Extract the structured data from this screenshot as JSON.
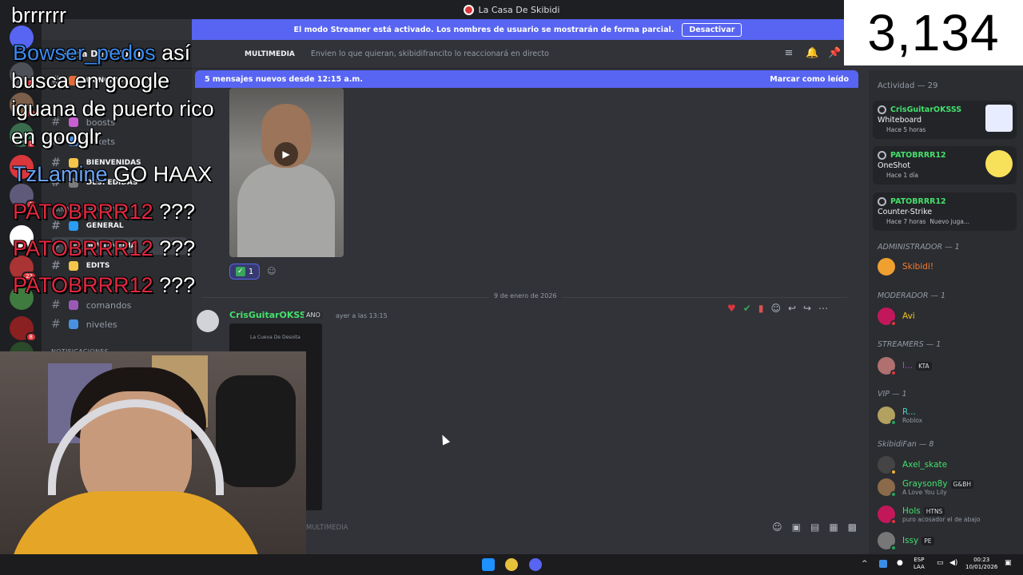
{
  "window": {
    "title": "La Casa De Skibidi"
  },
  "banner": {
    "text": "El modo Streamer está activado. Los nombres de usuario se mostrarán de forma parcial.",
    "button": "Desactivar"
  },
  "server_badges": [
    "1",
    "1",
    "1",
    "1",
    "1",
    "23",
    "8"
  ],
  "channels": {
    "server_name": "Casa De Skibidi",
    "items": [
      {
        "label": "NUNCIOS",
        "style": "bold"
      },
      {
        "label": "boosts",
        "style": "normal"
      },
      {
        "label": "tickets",
        "style": "normal"
      },
      {
        "label": "BIENVENIDAS",
        "style": "bold"
      },
      {
        "label": "DESPEDIDAS",
        "style": "bold"
      },
      {
        "label": "GENERAL",
        "style": "bold"
      },
      {
        "label": "MULTIMEDIA",
        "style": "bold"
      },
      {
        "label": "EDITS",
        "style": "bold"
      },
      {
        "label": "comandos",
        "style": "normal"
      },
      {
        "label": "niveles",
        "style": "normal"
      }
    ],
    "category_general": "CANALES PRINCIPALES",
    "category_notif": "NOTIFICACIONES"
  },
  "chanbar": {
    "name": "MULTIMEDIA",
    "topic": "Envien lo que quieran, skibidifrancito lo reaccionará en directo"
  },
  "newbar": {
    "text": "5 mensajes nuevos desde 12:15 a.m.",
    "action": "Marcar como leído"
  },
  "message1": {
    "reaction_count": "1"
  },
  "divider": {
    "date": "9 de enero de 2026"
  },
  "message2": {
    "author": "CrisGuitarOKSSS",
    "tag": "ANO",
    "time": "ayer a las 13:15",
    "image_text": "La Cueva De Desoita"
  },
  "composer": {
    "placeholder": "MULTIMEDIA"
  },
  "members": {
    "activity_header": "Actividad — 29",
    "activities": [
      {
        "name": "CrisGuitarOKSSS",
        "game": "Whiteboard",
        "time": "Hace 5 horas"
      },
      {
        "name": "PATOBRRR12",
        "game": "OneShot",
        "time": "Hace 1 día"
      },
      {
        "name": "PATOBRRR12",
        "game": "Counter-Strike",
        "time": "Hace 7 horas",
        "extra": "Nuevo juga..."
      }
    ],
    "roles": [
      {
        "title": "ADMINISTRADOR — 1",
        "members": [
          {
            "name": "Skibidi!",
            "color": "#f47b36"
          }
        ]
      },
      {
        "title": "MODERADOR — 1",
        "members": [
          {
            "name": "Avi",
            "color": "#f0c419"
          }
        ]
      },
      {
        "title": "STREAMERS — 1",
        "members": [
          {
            "name": "I...",
            "color": "#c13dd9",
            "tag": "KTA"
          }
        ]
      },
      {
        "title": "VIP — 1",
        "members": [
          {
            "name": "R...",
            "color": "#3fd4c0",
            "sub": "Roblox"
          }
        ]
      },
      {
        "title": "SkibidiFan — 8",
        "members": [
          {
            "name": "Axel_skate",
            "color": "#43e06b"
          },
          {
            "name": "Grayson8y",
            "color": "#43e06b",
            "tag": "G&BH",
            "sub": "A Love You Lily"
          },
          {
            "name": "Hols",
            "color": "#43e06b",
            "tag": "HTNS",
            "sub": "puro acosador el de abajo"
          },
          {
            "name": "Issy",
            "color": "#43e06b",
            "tag": "PE"
          }
        ]
      }
    ]
  },
  "viewer_count": "3,134",
  "overlay": {
    "lines": [
      {
        "user": "",
        "text": "brrrrrr"
      },
      {
        "user": "Bowser_pedos",
        "text": "así"
      },
      {
        "user": "",
        "text": "busca en google"
      },
      {
        "user": "",
        "text": "iguana de puerto rico"
      },
      {
        "user": "",
        "text": "en googlr"
      },
      {
        "user": "TzLamine",
        "text": "GO HAAX"
      },
      {
        "user": "PATOBRRR12",
        "text": "???"
      },
      {
        "user": "PATOBRRR12",
        "text": "???"
      },
      {
        "user": "PATOBRRR12",
        "text": "???"
      }
    ]
  },
  "taskbar": {
    "lang": "ESP",
    "lang2": "LAA",
    "time": "00:23",
    "date": "10/01/2026"
  }
}
